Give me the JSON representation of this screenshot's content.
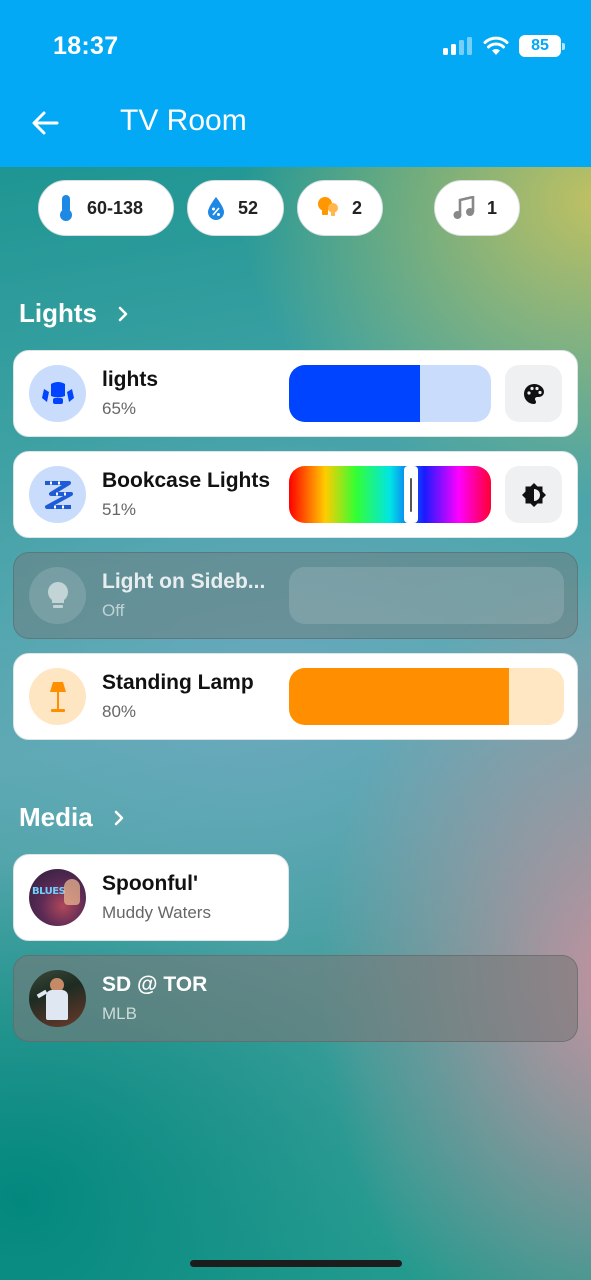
{
  "status_bar": {
    "time": "18:37",
    "battery": "85"
  },
  "header": {
    "title": "TV Room"
  },
  "chips": [
    {
      "icon": "thermometer-icon",
      "value": "60-138"
    },
    {
      "icon": "humidity-icon",
      "value": "52"
    },
    {
      "icon": "lights-on-icon",
      "value": "2"
    },
    {
      "icon": "music-note-icon",
      "value": "1"
    }
  ],
  "lights_section": {
    "title": "Lights",
    "items": [
      {
        "name": "lights",
        "state": "65%",
        "brightness": 0.65,
        "color": "#0044ff",
        "icon": "ceiling-light-icon",
        "action_icon": "palette-icon"
      },
      {
        "name": "Bookcase Lights",
        "state": "51%",
        "brightness": 0.51,
        "icon": "led-strip-icon",
        "action_icon": "brightness-icon"
      },
      {
        "name": "Light on Sideb...",
        "state": "Off",
        "brightness": 0,
        "icon": "bulb-icon"
      },
      {
        "name": "Standing Lamp",
        "state": "80%",
        "brightness": 0.8,
        "color": "#ff8f00",
        "icon": "floor-lamp-icon"
      }
    ]
  },
  "media_section": {
    "title": "Media",
    "items": [
      {
        "title": "Spoonful'",
        "artist": "Muddy Waters",
        "art_text": "BLUES"
      },
      {
        "title": "SD @ TOR",
        "artist": "MLB"
      }
    ]
  },
  "colors": {
    "app_bar": "#03a9f4",
    "accent_blue": "#0044ff",
    "accent_orange": "#ff8f00"
  }
}
